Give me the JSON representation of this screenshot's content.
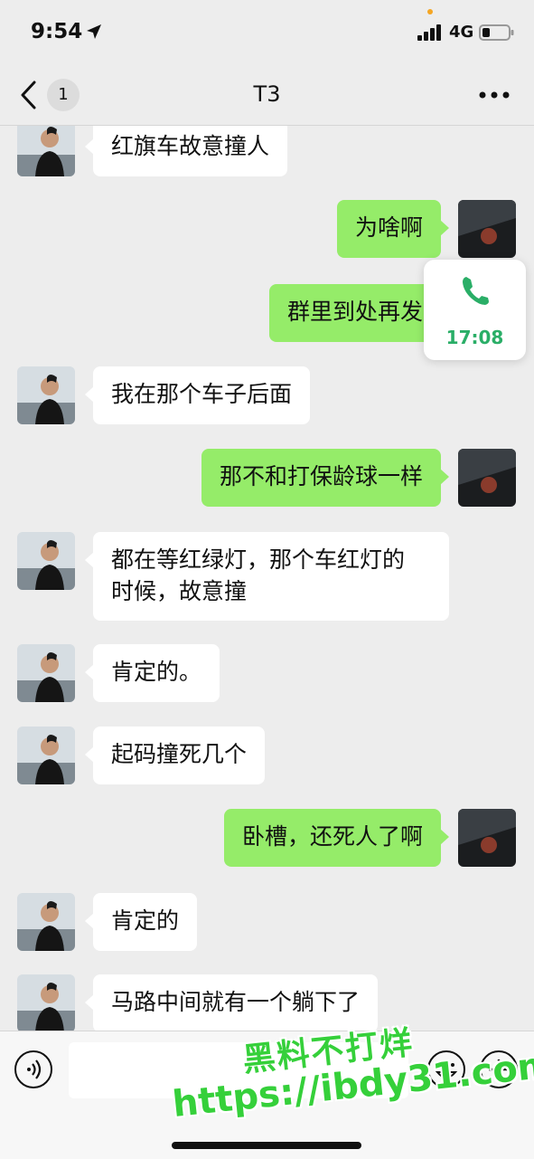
{
  "status_bar": {
    "time": "9:54",
    "network": "4G"
  },
  "nav": {
    "unread_count": "1",
    "title": "T3"
  },
  "messages": [
    {
      "side": "left",
      "text": "红旗车故意撞人"
    },
    {
      "side": "right",
      "text": "为啥啊"
    },
    {
      "side": "right",
      "text": "群里到处再发"
    },
    {
      "side": "left",
      "text": "我在那个车子后面"
    },
    {
      "side": "right",
      "text": "那不和打保龄球一样"
    },
    {
      "side": "left",
      "text": "都在等红绿灯，那个车红灯的\n时候，故意撞"
    },
    {
      "side": "left",
      "text": "肯定的。"
    },
    {
      "side": "left",
      "text": "起码撞死几个"
    },
    {
      "side": "right",
      "text": "卧槽，还死人了啊"
    },
    {
      "side": "left",
      "text": "肯定的"
    },
    {
      "side": "left",
      "text": "马路中间就有一个躺下了"
    }
  ],
  "call_widget": {
    "duration": "17:08",
    "accent": "#2aae67"
  },
  "watermark": {
    "line1": "黑料不打烊",
    "line2": "https://ibdy31.com"
  },
  "colors": {
    "sent_bubble": "#95ec69",
    "received_bubble": "#ffffff",
    "background": "#ededed"
  }
}
